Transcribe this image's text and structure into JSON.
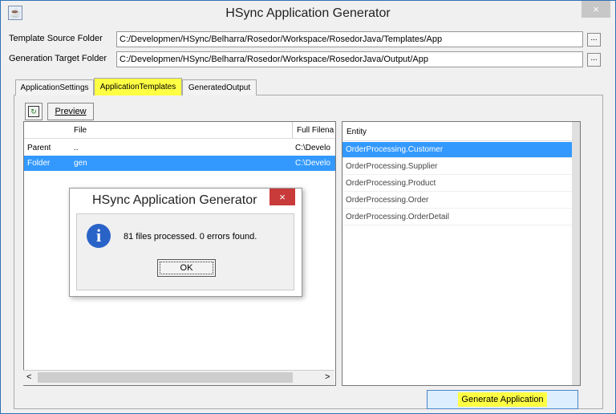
{
  "window": {
    "title": "HSync Application Generator",
    "close_glyph": "×",
    "icon": "java-cup-icon"
  },
  "form": {
    "template_source_label": "Template Source Folder",
    "template_source_value": "C:/Developmen/HSync/Belharra/Rosedor/Workspace/RosedorJava/Templates/App",
    "generation_target_label": "Generation Target Folder",
    "generation_target_value": "C:/Developmen/HSync/Belharra/Rosedor/Workspace/RosedorJava/Output/App",
    "browse_label": "..."
  },
  "tabs": [
    {
      "label": "ApplicationSettings",
      "active": false
    },
    {
      "label": "ApplicationTemplates",
      "active": true
    },
    {
      "label": "GeneratedOutput",
      "active": false
    }
  ],
  "toolbar": {
    "refresh_icon": "refresh-icon",
    "preview_label": "Preview"
  },
  "file_table": {
    "columns": [
      "",
      "File",
      "Full Filena"
    ],
    "rows": [
      {
        "type": "Parent",
        "file": "..",
        "full": "C:\\Develo",
        "selected": false
      },
      {
        "type": "Folder",
        "file": "gen",
        "full": "C:\\Develo",
        "selected": true
      }
    ],
    "scroll_left": "<",
    "scroll_right": ">"
  },
  "entity_list": {
    "header": "Entity",
    "items": [
      {
        "label": "OrderProcessing.Customer",
        "selected": true
      },
      {
        "label": "OrderProcessing.Supplier",
        "selected": false
      },
      {
        "label": "OrderProcessing.Product",
        "selected": false
      },
      {
        "label": "OrderProcessing.Order",
        "selected": false
      },
      {
        "label": "OrderProcessing.OrderDetail",
        "selected": false
      }
    ]
  },
  "generate_button_label": "Generate Application",
  "dialog": {
    "title": "HSync Application Generator",
    "close_glyph": "×",
    "icon": "info-icon",
    "icon_glyph": "i",
    "message": "81 files processed.  0 errors found.",
    "ok_label": "OK"
  },
  "colors": {
    "highlight": "#ffff44",
    "selection": "#3399ff",
    "dialog_close": "#c93a3a",
    "info_icon": "#2a63c8"
  }
}
